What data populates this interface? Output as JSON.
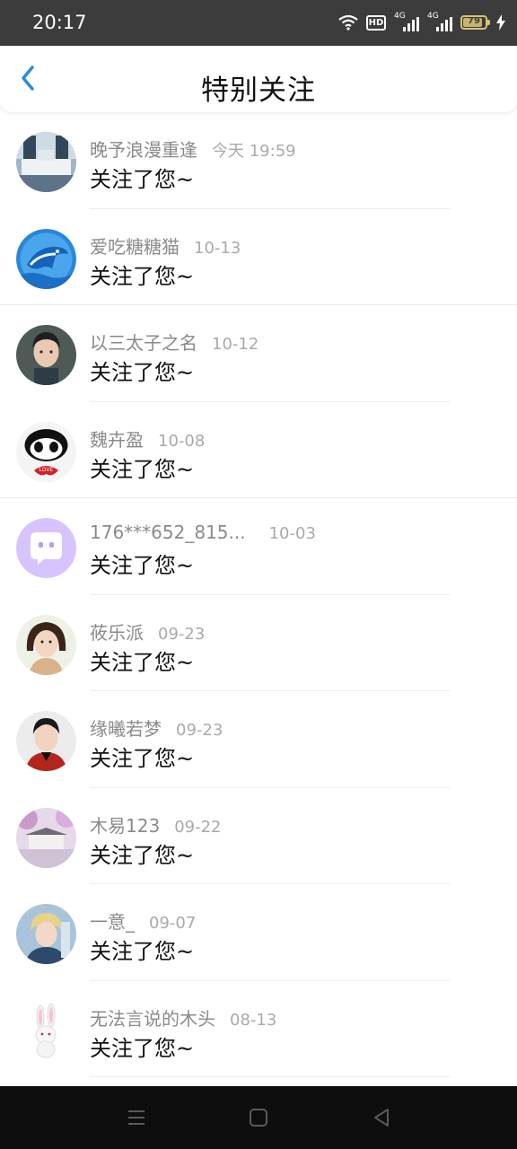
{
  "status_bar": {
    "time": "20:17",
    "hd_label": "HD",
    "network1": "4G",
    "network2": "4G",
    "battery": "79"
  },
  "header": {
    "title": "特别关注"
  },
  "colors": {
    "accent": "#2a8be0",
    "status_bar": "#3c3c3c",
    "nav_bar": "#0e0e0e"
  },
  "items": [
    {
      "name": "晚予浪漫重逢",
      "time": "今天 19:59",
      "message": "关注了您~",
      "avatar_icon": "room-photo-avatar"
    },
    {
      "name": "爱吃糖糖猫",
      "time": "10-13",
      "message": "关注了您~",
      "avatar_icon": "dolphin-avatar"
    },
    {
      "name": "以三太子之名",
      "time": "10-12",
      "message": "关注了您~",
      "avatar_icon": "person-avatar"
    },
    {
      "name": "魏卉盈",
      "time": "10-08",
      "message": "关注了您~",
      "avatar_icon": "panda-avatar"
    },
    {
      "name": "176***652_815...",
      "time": "10-03",
      "message": "关注了您~",
      "avatar_icon": "chat-bubble-avatar"
    },
    {
      "name": "莜乐派",
      "time": "09-23",
      "message": "关注了您~",
      "avatar_icon": "girl-avatar"
    },
    {
      "name": "缘曦若梦",
      "time": "09-23",
      "message": "关注了您~",
      "avatar_icon": "man-avatar"
    },
    {
      "name": "木易123",
      "time": "09-22",
      "message": "关注了您~",
      "avatar_icon": "pavilion-avatar"
    },
    {
      "name": "一意_",
      "time": "09-07",
      "message": "关注了您~",
      "avatar_icon": "anime-avatar"
    },
    {
      "name": "无法言说的木头",
      "time": "08-13",
      "message": "关注了您~",
      "avatar_icon": "rabbit-avatar"
    }
  ],
  "nav_bar": {
    "buttons": [
      "menu-icon",
      "home-icon",
      "back-icon"
    ]
  }
}
